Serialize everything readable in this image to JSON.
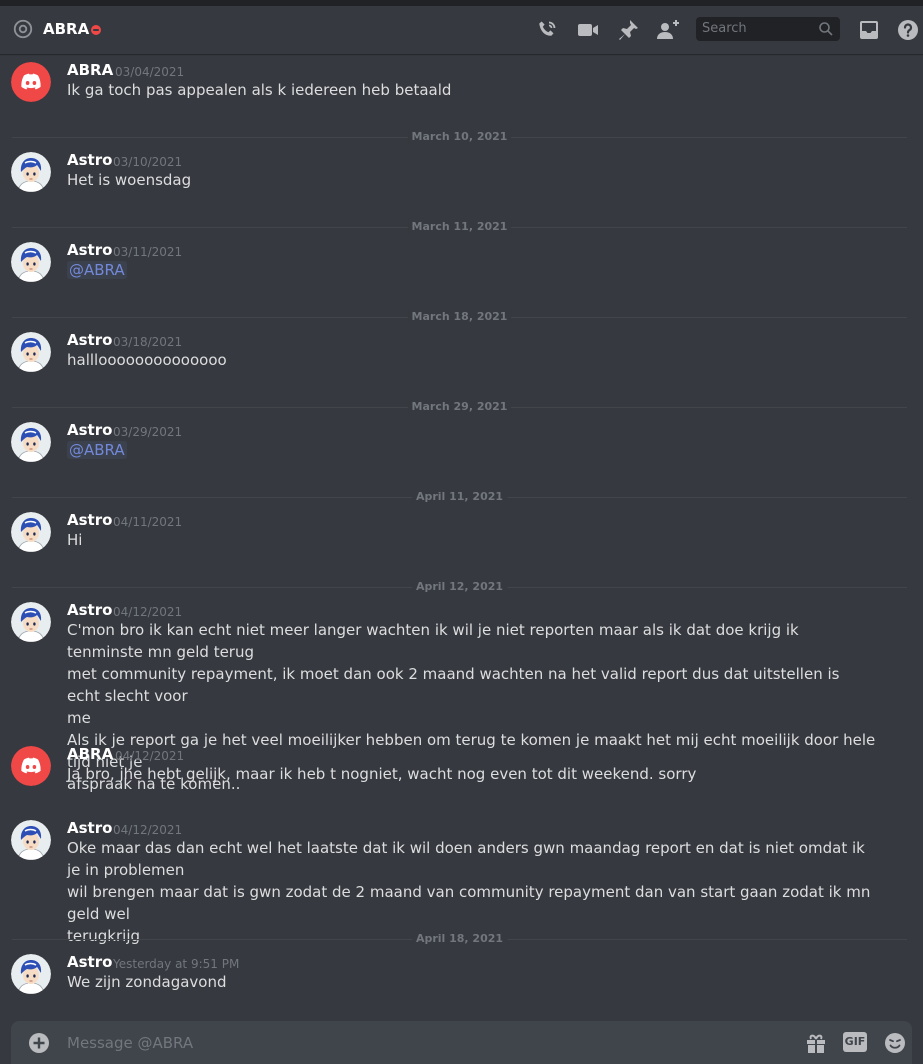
{
  "header": {
    "title": "ABRA",
    "status": "do-not-disturb",
    "search_placeholder": "Search",
    "icons": [
      "at-icon",
      "call-icon",
      "video-icon",
      "pin-icon",
      "add-friend-icon",
      "search-icon",
      "inbox-icon",
      "help-icon"
    ]
  },
  "colors": {
    "background": "#36393f",
    "discord_red": "#f04747",
    "mention": "#7289da",
    "muted": "#72767d",
    "astro_avatar_bg": "#e8edf0"
  },
  "messages": [
    {
      "author": "ABRA",
      "avatar": "discord-logo",
      "timestamp": "03/04/2021",
      "text": "Ik ga toch pas appealen als k iedereen heb betaald"
    },
    {
      "divider": "March 10, 2021"
    },
    {
      "author": "Astro",
      "avatar": "anime-boy",
      "timestamp": "03/10/2021",
      "text": "Het is woensdag"
    },
    {
      "divider": "March 11, 2021"
    },
    {
      "author": "Astro",
      "avatar": "anime-boy",
      "timestamp": "03/11/2021",
      "text": "@ABRA"
    },
    {
      "divider": "March 18, 2021"
    },
    {
      "author": "Astro",
      "avatar": "anime-boy",
      "timestamp": "03/18/2021",
      "text": "hallloooooooooooooo"
    },
    {
      "divider": "March 29, 2021"
    },
    {
      "author": "Astro",
      "avatar": "anime-boy",
      "timestamp": "03/29/2021",
      "text": "@ABRA"
    },
    {
      "divider": "April 11, 2021"
    },
    {
      "author": "Astro",
      "avatar": "anime-boy",
      "timestamp": "04/11/2021",
      "text": "Hi"
    },
    {
      "divider": "April 12, 2021"
    },
    {
      "author": "Astro",
      "avatar": "anime-boy",
      "timestamp": "04/12/2021",
      "lines": [
        "C'mon bro ik kan echt niet meer langer wachten ik wil je niet reporten maar als ik dat doe krijg ik tenminste mn geld terug",
        "met community repayment, ik moet dan ook 2 maand wachten na het valid report dus dat uitstellen is echt slecht voor",
        "me",
        "Als ik je report ga je het veel moeilijker hebben om terug te komen je maakt het mij echt moeilijk door hele tijd niet je",
        "afspraak na te komen.."
      ]
    },
    {
      "author": "ABRA",
      "avatar": "discord-logo",
      "timestamp": "04/12/2021",
      "text": "Ja bro, jhe hebt gelijk, maar ik heb t nogniet, wacht nog even tot dit weekend. sorry"
    },
    {
      "author": "Astro",
      "avatar": "anime-boy",
      "timestamp": "04/12/2021",
      "lines": [
        "Oke maar das dan echt wel het laatste dat ik wil doen anders gwn maandag report en dat is niet omdat ik je in problemen",
        "wil brengen maar dat is gwn zodat de 2 maand van community repayment dan van start gaan zodat ik mn geld wel",
        "terugkrijg"
      ]
    },
    {
      "divider": "April 18, 2021"
    },
    {
      "author": "Astro",
      "avatar": "anime-boy",
      "timestamp": "Yesterday at 9:51 PM",
      "text": "We zijn zondagavond"
    }
  ],
  "composer": {
    "placeholder": "Message @ABRA",
    "gif_label": "GIF",
    "icons": [
      "add-icon",
      "gift-icon",
      "emoji-icon"
    ]
  }
}
